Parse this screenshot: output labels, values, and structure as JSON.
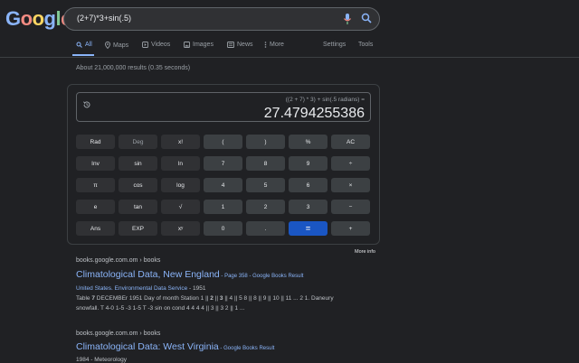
{
  "logo": {
    "letters": [
      "G",
      "o",
      "o",
      "g",
      "l",
      "e"
    ],
    "colors": [
      "#8ab4f8",
      "#f28b82",
      "#fdd663",
      "#8ab4f8",
      "#81c995",
      "#f28b82"
    ]
  },
  "search": {
    "query": "(2+7)*3+sin(.5)"
  },
  "tabs": [
    {
      "label": "All",
      "icon": "search-icon",
      "active": true
    },
    {
      "label": "Maps",
      "icon": "map-pin-icon"
    },
    {
      "label": "Videos",
      "icon": "video-icon"
    },
    {
      "label": "Images",
      "icon": "image-icon"
    },
    {
      "label": "News",
      "icon": "news-icon"
    },
    {
      "label": "More",
      "icon": "more-vert-icon"
    },
    {
      "label": "Settings"
    },
    {
      "label": "Tools"
    }
  ],
  "result_stats": "About 21,000,000 results (0.35 seconds)",
  "calculator": {
    "expression": "((2 + 7) * 3) + sin(.5 radians) =",
    "result": "27.4794255386",
    "keys": [
      [
        "Rad",
        "Deg",
        "x!",
        "(",
        ")",
        "%",
        "AC"
      ],
      [
        "Inv",
        "sin",
        "ln",
        "7",
        "8",
        "9",
        "÷"
      ],
      [
        "π",
        "cos",
        "log",
        "4",
        "5",
        "6",
        "×"
      ],
      [
        "e",
        "tan",
        "√",
        "1",
        "2",
        "3",
        "−"
      ],
      [
        "Ans",
        "EXP",
        "xʸ",
        "0",
        ".",
        "=",
        "+"
      ]
    ],
    "more_info": "More info"
  },
  "results": [
    {
      "url": "books.google.com.om › books",
      "title": "Climatological Data, New England",
      "title_tail": " - Page 358 - Google Books Result",
      "sub_link": "United States. Environmental Data Service",
      "sub_tail": " - 1951",
      "snippet1_pre": "Table ",
      "snippet1_b1": "7",
      "snippet1_mid": " DECEMBEr 1951 Day of month Station 1 || ",
      "snippet1_b2": "2",
      "snippet1_mid2": " || ",
      "snippet1_b3": "3",
      "snippet1_rest": " || 4 || 5 8 || 8 || 9 || 10 || 11 ... 2 1. Daneury",
      "snippet2": "snowfall. T 4-0 1-5 -3 1-5 T -3 sin on cond 4 4 4 4 || 3 || 3 2 || 1 ..."
    },
    {
      "url": "books.google.com.om › books",
      "title": "Climatological Data: West Virginia",
      "title_tail": " - Google Books Result",
      "sub_plain": "1984 - Meteorology"
    }
  ]
}
